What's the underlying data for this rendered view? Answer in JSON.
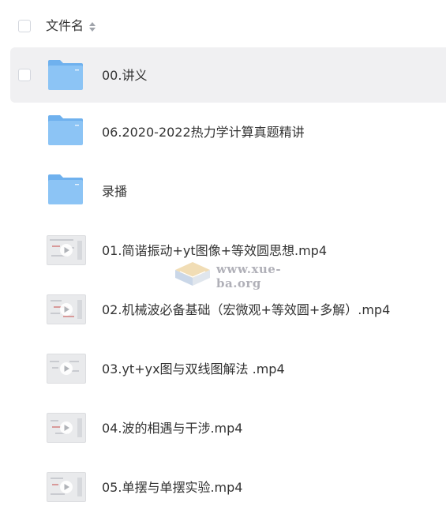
{
  "header": {
    "column_label": "文件名",
    "sort_icon": "sort-arrows-icon"
  },
  "files": [
    {
      "name": "00.讲义",
      "type": "folder"
    },
    {
      "name": "06.2020-2022热力学计算真题精讲",
      "type": "folder"
    },
    {
      "name": "录播",
      "type": "folder"
    },
    {
      "name": "01.简谐振动+yt图像+等效圆思想.mp4",
      "type": "video"
    },
    {
      "name": "02.机械波必备基础（宏微观+等效圆+多解）.mp4",
      "type": "video"
    },
    {
      "name": "03.yt+yx图与双线图解法 .mp4",
      "type": "video"
    },
    {
      "name": "04.波的相遇与干涉.mp4",
      "type": "video"
    },
    {
      "name": "05.单摆与单摆实验.mp4",
      "type": "video"
    }
  ],
  "watermark": {
    "text": "www.xue-ba.org"
  },
  "colors": {
    "folder": "#8cc4f5",
    "folder_tab": "#a9d3f8",
    "hover_row": "#f0f0f2",
    "text": "#333333"
  }
}
